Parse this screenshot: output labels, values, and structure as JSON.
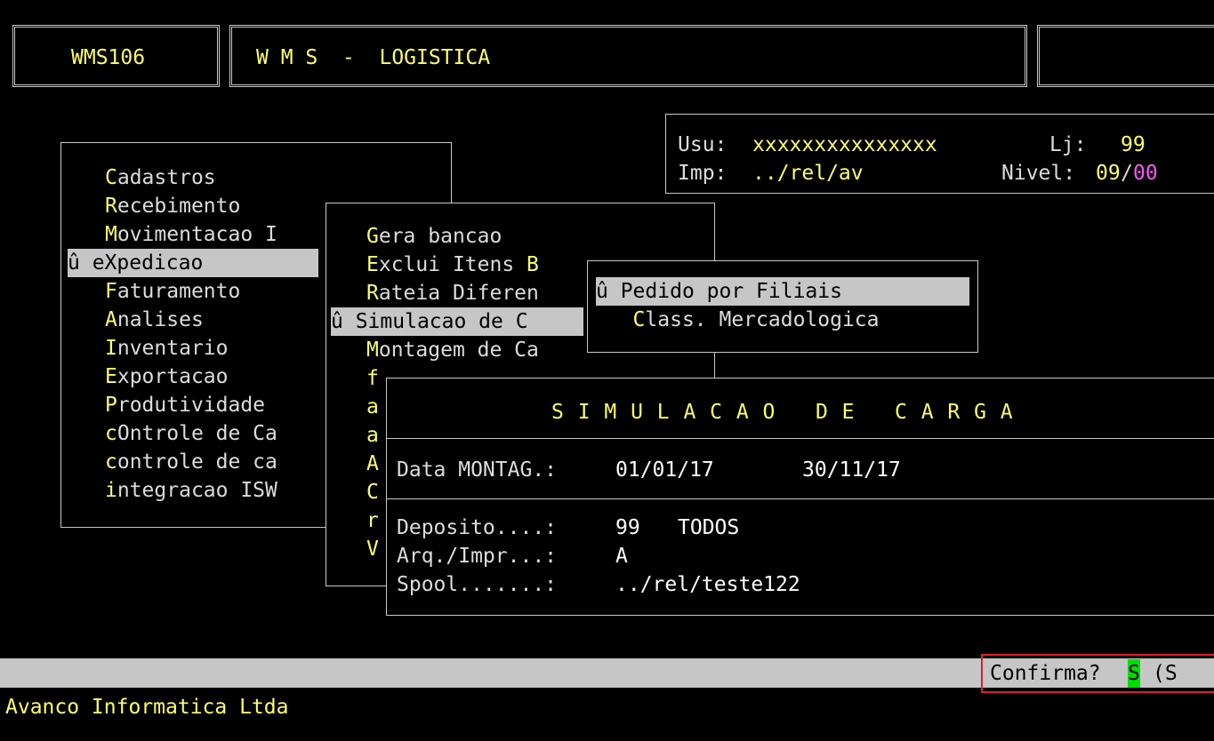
{
  "header": {
    "program_code": "WMS106",
    "system_title": "W M S  -  LOGISTICA"
  },
  "user_info": {
    "user_label": "Usu:",
    "user_value": "xxxxxxxxxxxxxxx",
    "store_label": "Lj:",
    "store_value": "99",
    "printer_label": "Imp:",
    "printer_value": "../rel/av",
    "level_label": "Nivel:",
    "level_value": "09",
    "level_separator": "/",
    "level_sub": "00"
  },
  "main_menu": {
    "items": [
      {
        "hot": "C",
        "rest": "adastros",
        "prefix": ""
      },
      {
        "hot": "R",
        "rest": "ecebimento",
        "prefix": ""
      },
      {
        "hot": "M",
        "rest": "ovimentacao I",
        "prefix": ""
      },
      {
        "hot": "",
        "rest": "eXpedicao",
        "prefix": "û ",
        "selected": true
      },
      {
        "hot": "F",
        "rest": "aturamento",
        "prefix": ""
      },
      {
        "hot": "A",
        "rest": "nalises",
        "prefix": ""
      },
      {
        "hot": "I",
        "rest": "nventario",
        "prefix": ""
      },
      {
        "hot": "E",
        "rest": "xportacao",
        "prefix": ""
      },
      {
        "hot": "P",
        "rest": "rodutividade",
        "prefix": ""
      },
      {
        "hot": "c",
        "rest": "Ontrole de Ca",
        "prefix": "",
        "hot_full": "cO"
      },
      {
        "hot": "c",
        "rest": "ontrole de ca",
        "prefix": ""
      },
      {
        "hot": "i",
        "rest": "ntegracao ISW",
        "prefix": ""
      }
    ]
  },
  "expedicao_menu": {
    "items": [
      {
        "hot": "G",
        "rest": "era bancao"
      },
      {
        "hot": "E",
        "rest": "xclui Itens ",
        "tail": "B"
      },
      {
        "hot": "R",
        "rest": "ateia Diferen"
      },
      {
        "hot": "",
        "rest": "Simulacao de C",
        "prefix": "û ",
        "selected": true
      },
      {
        "hot": "M",
        "rest": "ontagem de Ca"
      },
      {
        "hot": "f",
        "rest": ""
      },
      {
        "hot": "a",
        "rest": ""
      },
      {
        "hot": "a",
        "rest": ""
      },
      {
        "hot": "A",
        "rest": ""
      },
      {
        "hot": "C",
        "rest": ""
      },
      {
        "hot": "r",
        "rest": ""
      },
      {
        "hot": "V",
        "rest": ""
      }
    ]
  },
  "simulacao_menu": {
    "items": [
      {
        "prefix": "û ",
        "label": "Pedido por Filiais",
        "selected": true
      },
      {
        "prefix": "   ",
        "hot": "C",
        "label": "lass. Mercadologica"
      }
    ]
  },
  "form": {
    "title": "S I M U L A C A O   D E   C A R G A",
    "data_label": "Data MONTAG.:",
    "data_from": "01/01/17",
    "data_to": "30/11/17",
    "deposito_label": "Deposito....:",
    "deposito_code": "99",
    "deposito_name": "TODOS",
    "arq_label": "Arq./Impr...:",
    "arq_value": "A",
    "spool_label": "Spool.......:",
    "spool_value": "../rel/teste122"
  },
  "status_bar": {
    "confirm_label": "Confirma?",
    "confirm_value": "S",
    "confirm_options": "(S"
  },
  "footer": {
    "company": "Avanco Informatica Ltda"
  },
  "colors": {
    "background": "#000000",
    "highlight_text": "#ffff66",
    "normal_text": "#dcdcdc",
    "selection_bg": "#c6c6c6",
    "accent_magenta": "#ff55ff",
    "confirm_green": "#00cc00",
    "focus_red": "#e02020"
  }
}
